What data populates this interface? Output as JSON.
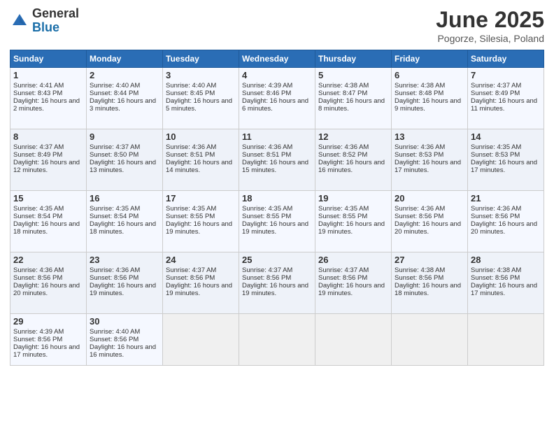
{
  "logo": {
    "general": "General",
    "blue": "Blue"
  },
  "title": "June 2025",
  "subtitle": "Pogorze, Silesia, Poland",
  "days": [
    "Sunday",
    "Monday",
    "Tuesday",
    "Wednesday",
    "Thursday",
    "Friday",
    "Saturday"
  ],
  "weeks": [
    [
      {
        "day": "1",
        "sunrise": "Sunrise: 4:41 AM",
        "sunset": "Sunset: 8:43 PM",
        "daylight": "Daylight: 16 hours and 2 minutes."
      },
      {
        "day": "2",
        "sunrise": "Sunrise: 4:40 AM",
        "sunset": "Sunset: 8:44 PM",
        "daylight": "Daylight: 16 hours and 3 minutes."
      },
      {
        "day": "3",
        "sunrise": "Sunrise: 4:40 AM",
        "sunset": "Sunset: 8:45 PM",
        "daylight": "Daylight: 16 hours and 5 minutes."
      },
      {
        "day": "4",
        "sunrise": "Sunrise: 4:39 AM",
        "sunset": "Sunset: 8:46 PM",
        "daylight": "Daylight: 16 hours and 6 minutes."
      },
      {
        "day": "5",
        "sunrise": "Sunrise: 4:38 AM",
        "sunset": "Sunset: 8:47 PM",
        "daylight": "Daylight: 16 hours and 8 minutes."
      },
      {
        "day": "6",
        "sunrise": "Sunrise: 4:38 AM",
        "sunset": "Sunset: 8:48 PM",
        "daylight": "Daylight: 16 hours and 9 minutes."
      },
      {
        "day": "7",
        "sunrise": "Sunrise: 4:37 AM",
        "sunset": "Sunset: 8:49 PM",
        "daylight": "Daylight: 16 hours and 11 minutes."
      }
    ],
    [
      {
        "day": "8",
        "sunrise": "Sunrise: 4:37 AM",
        "sunset": "Sunset: 8:49 PM",
        "daylight": "Daylight: 16 hours and 12 minutes."
      },
      {
        "day": "9",
        "sunrise": "Sunrise: 4:37 AM",
        "sunset": "Sunset: 8:50 PM",
        "daylight": "Daylight: 16 hours and 13 minutes."
      },
      {
        "day": "10",
        "sunrise": "Sunrise: 4:36 AM",
        "sunset": "Sunset: 8:51 PM",
        "daylight": "Daylight: 16 hours and 14 minutes."
      },
      {
        "day": "11",
        "sunrise": "Sunrise: 4:36 AM",
        "sunset": "Sunset: 8:51 PM",
        "daylight": "Daylight: 16 hours and 15 minutes."
      },
      {
        "day": "12",
        "sunrise": "Sunrise: 4:36 AM",
        "sunset": "Sunset: 8:52 PM",
        "daylight": "Daylight: 16 hours and 16 minutes."
      },
      {
        "day": "13",
        "sunrise": "Sunrise: 4:36 AM",
        "sunset": "Sunset: 8:53 PM",
        "daylight": "Daylight: 16 hours and 17 minutes."
      },
      {
        "day": "14",
        "sunrise": "Sunrise: 4:35 AM",
        "sunset": "Sunset: 8:53 PM",
        "daylight": "Daylight: 16 hours and 17 minutes."
      }
    ],
    [
      {
        "day": "15",
        "sunrise": "Sunrise: 4:35 AM",
        "sunset": "Sunset: 8:54 PM",
        "daylight": "Daylight: 16 hours and 18 minutes."
      },
      {
        "day": "16",
        "sunrise": "Sunrise: 4:35 AM",
        "sunset": "Sunset: 8:54 PM",
        "daylight": "Daylight: 16 hours and 18 minutes."
      },
      {
        "day": "17",
        "sunrise": "Sunrise: 4:35 AM",
        "sunset": "Sunset: 8:55 PM",
        "daylight": "Daylight: 16 hours and 19 minutes."
      },
      {
        "day": "18",
        "sunrise": "Sunrise: 4:35 AM",
        "sunset": "Sunset: 8:55 PM",
        "daylight": "Daylight: 16 hours and 19 minutes."
      },
      {
        "day": "19",
        "sunrise": "Sunrise: 4:35 AM",
        "sunset": "Sunset: 8:55 PM",
        "daylight": "Daylight: 16 hours and 19 minutes."
      },
      {
        "day": "20",
        "sunrise": "Sunrise: 4:36 AM",
        "sunset": "Sunset: 8:56 PM",
        "daylight": "Daylight: 16 hours and 20 minutes."
      },
      {
        "day": "21",
        "sunrise": "Sunrise: 4:36 AM",
        "sunset": "Sunset: 8:56 PM",
        "daylight": "Daylight: 16 hours and 20 minutes."
      }
    ],
    [
      {
        "day": "22",
        "sunrise": "Sunrise: 4:36 AM",
        "sunset": "Sunset: 8:56 PM",
        "daylight": "Daylight: 16 hours and 20 minutes."
      },
      {
        "day": "23",
        "sunrise": "Sunrise: 4:36 AM",
        "sunset": "Sunset: 8:56 PM",
        "daylight": "Daylight: 16 hours and 19 minutes."
      },
      {
        "day": "24",
        "sunrise": "Sunrise: 4:37 AM",
        "sunset": "Sunset: 8:56 PM",
        "daylight": "Daylight: 16 hours and 19 minutes."
      },
      {
        "day": "25",
        "sunrise": "Sunrise: 4:37 AM",
        "sunset": "Sunset: 8:56 PM",
        "daylight": "Daylight: 16 hours and 19 minutes."
      },
      {
        "day": "26",
        "sunrise": "Sunrise: 4:37 AM",
        "sunset": "Sunset: 8:56 PM",
        "daylight": "Daylight: 16 hours and 19 minutes."
      },
      {
        "day": "27",
        "sunrise": "Sunrise: 4:38 AM",
        "sunset": "Sunset: 8:56 PM",
        "daylight": "Daylight: 16 hours and 18 minutes."
      },
      {
        "day": "28",
        "sunrise": "Sunrise: 4:38 AM",
        "sunset": "Sunset: 8:56 PM",
        "daylight": "Daylight: 16 hours and 17 minutes."
      }
    ],
    [
      {
        "day": "29",
        "sunrise": "Sunrise: 4:39 AM",
        "sunset": "Sunset: 8:56 PM",
        "daylight": "Daylight: 16 hours and 17 minutes."
      },
      {
        "day": "30",
        "sunrise": "Sunrise: 4:40 AM",
        "sunset": "Sunset: 8:56 PM",
        "daylight": "Daylight: 16 hours and 16 minutes."
      },
      null,
      null,
      null,
      null,
      null
    ]
  ]
}
